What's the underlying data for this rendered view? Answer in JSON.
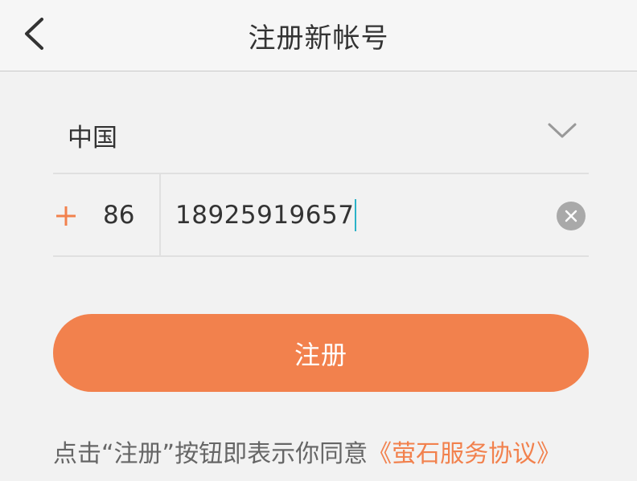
{
  "header": {
    "title": "注册新帐号",
    "back_icon": "chevron-left-icon"
  },
  "country": {
    "name": "中国",
    "chevron_icon": "chevron-down-icon"
  },
  "phone": {
    "plus_icon": "plus-icon",
    "country_code": "86",
    "number": "18925919657",
    "clear_icon": "clear-icon"
  },
  "register_button": {
    "label": "注册"
  },
  "agreement": {
    "text": "点击“注册”按钮即表示你同意",
    "link": "《萤石服务协议》"
  },
  "colors": {
    "accent": "#f2814d",
    "caret": "#2bb3c8",
    "background": "#f2f2f2"
  }
}
